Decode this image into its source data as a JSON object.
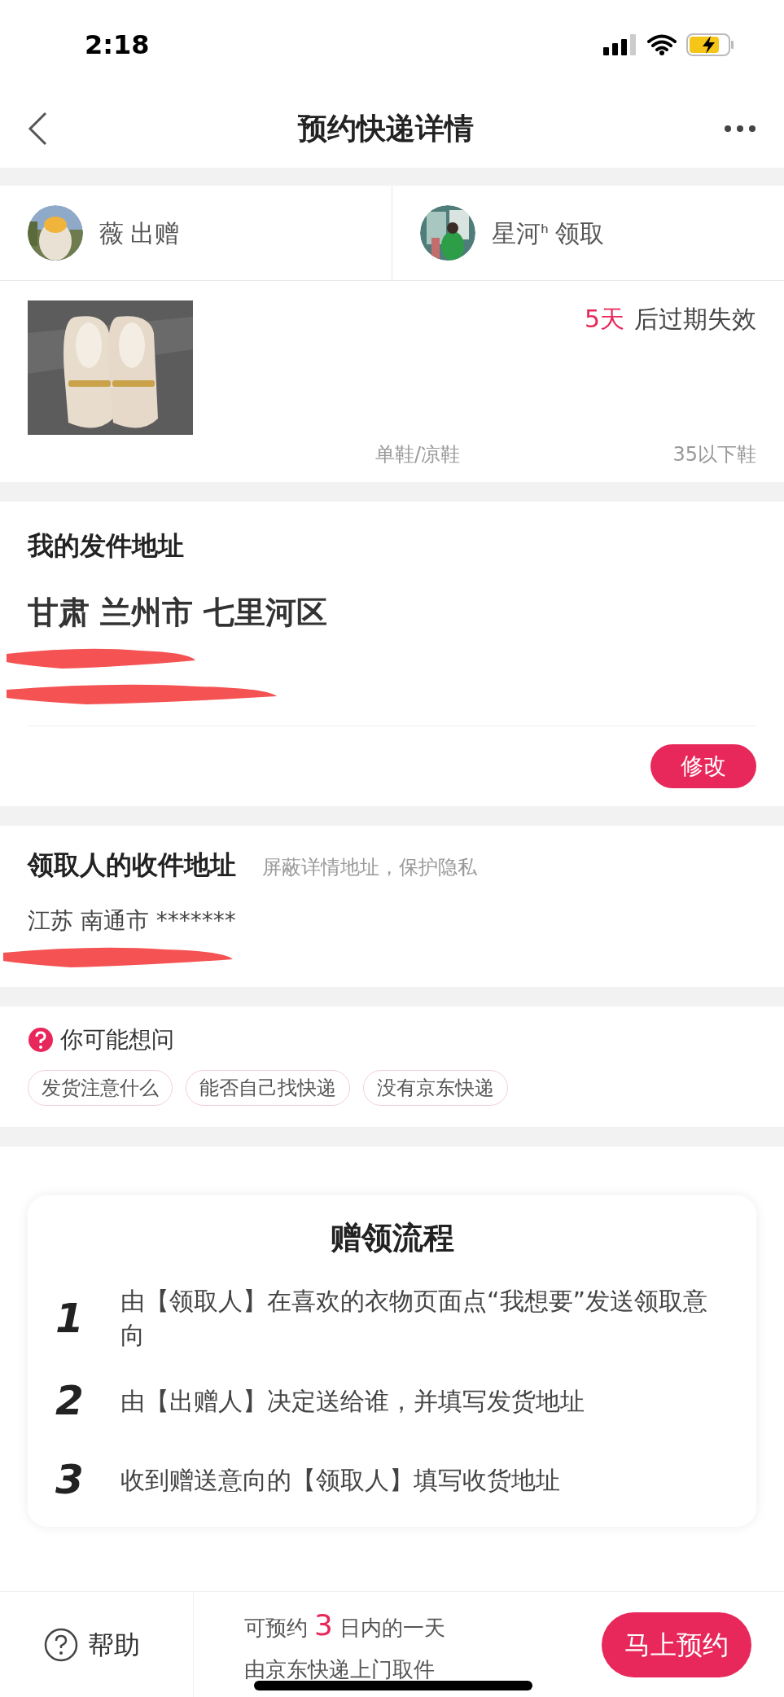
{
  "status_bar": {
    "time": "2:18"
  },
  "nav": {
    "title": "预约快递详情"
  },
  "parties": [
    {
      "name": "薇",
      "role": "出赠"
    },
    {
      "name": "星河ᑋ",
      "role": "领取"
    }
  ],
  "item": {
    "expire_days": "5天",
    "expire_text": "后过期失效",
    "category": "单鞋/凉鞋",
    "size": "35以下鞋"
  },
  "sender_address": {
    "title": "我的发件地址",
    "region": "甘肃 兰州市 七里河区",
    "edit_button": "修改"
  },
  "receiver_address": {
    "title": "领取人的收件地址",
    "note": "屏蔽详情地址，保护隐私",
    "region": "江苏 南通市 *******"
  },
  "faq": {
    "title": "你可能想问",
    "tags": [
      "发货注意什么",
      "能否自己找快递",
      "没有京东快递"
    ]
  },
  "process": {
    "title": "赠领流程",
    "steps": [
      {
        "number": "1",
        "text": "由【领取人】在喜欢的衣物页面点“我想要”发送领取意向"
      },
      {
        "number": "2",
        "text": "由【出赠人】决定送给谁，并填写发货地址"
      },
      {
        "number": "3",
        "text": "收到赠送意向的【领取人】填写收货地址"
      }
    ]
  },
  "bottom_bar": {
    "help": "帮助",
    "line1_pre": "可预约",
    "days": "3",
    "line1_post": "日内的一天",
    "line2": "由京东快递上门取件",
    "book_button": "马上预约"
  }
}
